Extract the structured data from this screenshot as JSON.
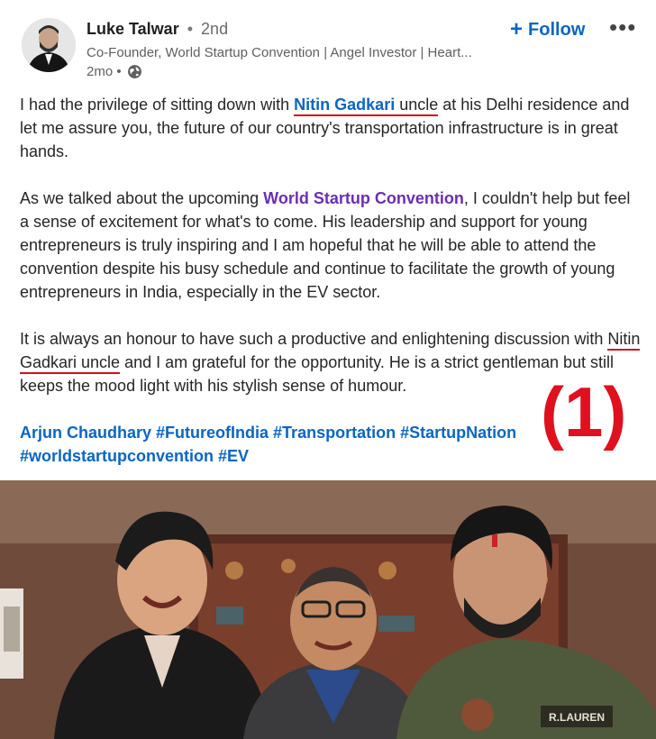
{
  "author": {
    "name": "Luke Talwar",
    "separator": "•",
    "degree": "2nd",
    "headline": "Co-Founder, World Startup Convention | Angel Investor | Heart...",
    "time": "2mo •"
  },
  "actions": {
    "follow_label": "Follow",
    "follow_plus": "+",
    "more_label": "•••"
  },
  "post": {
    "p1_before": "I had the privilege of sitting down with ",
    "p1_mention": "Nitin Gadkari",
    "p1_uncle": " uncle",
    "p1_after": " at his Delhi residence and let me assure you, the future of our country's transportation infrastructure is in great hands.",
    "p2_before": "As we talked about the upcoming ",
    "p2_mention": "World Startup Convention",
    "p2_after": ", I couldn't help but feel a sense of excitement for what's to come. His leadership and support for young entrepreneurs is truly inspiring and I am hopeful that he will be able to attend the convention despite his busy schedule and continue to facilitate the growth of young entrepreneurs in India, especially in the EV sector.",
    "p3_before": "It is always an honour to have such a productive and enlightening discussion with ",
    "p3_underlined": "Nitin Gadkari uncle",
    "p3_after": " and I am grateful for the opportunity. He is a strict gentleman but still keeps the mood light with his stylish sense of humour.",
    "tags": [
      "Arjun Chaudhary",
      "#FutureofIndia",
      "#Transportation",
      "#StartupNation",
      "#worldstartupconvention",
      "#EV"
    ]
  },
  "annotation": "(1)",
  "photo_text": {
    "jacket_label": "R.LAUREN"
  },
  "colors": {
    "link_blue": "#0a66c2",
    "purple_mention": "#6a2fb0",
    "underline_red": "#d0121b",
    "annotation_red": "#e0101e"
  }
}
